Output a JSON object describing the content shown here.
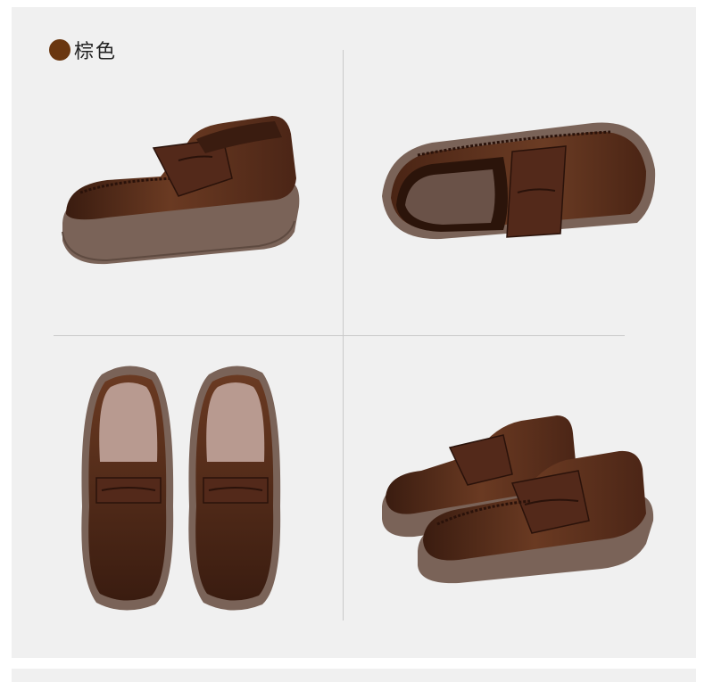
{
  "header": {
    "color_name": "棕色",
    "swatch_color": "#6a3710"
  },
  "views": [
    {
      "name": "side-view",
      "icon": "loafer-side"
    },
    {
      "name": "sole-angle-view",
      "icon": "loafer-tilted"
    },
    {
      "name": "top-pair-view",
      "icon": "loafer-pair-top"
    },
    {
      "name": "front-pair-view",
      "icon": "loafer-pair-front"
    }
  ],
  "colors": {
    "leather": "#5a2f1c",
    "sole": "#7a6358",
    "background": "#f0f0f0"
  }
}
